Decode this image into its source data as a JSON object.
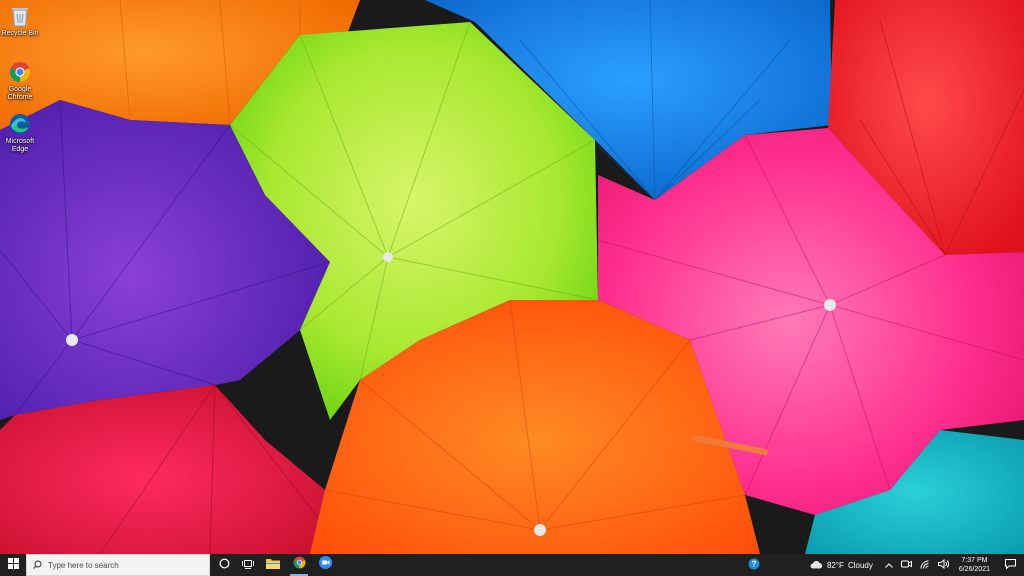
{
  "desktop": {
    "icons": [
      {
        "label": "Recycle Bin",
        "icon": "recycle-bin-icon"
      },
      {
        "label": "Google Chrome",
        "icon": "chrome-icon"
      },
      {
        "label": "Microsoft Edge",
        "icon": "edge-icon"
      }
    ]
  },
  "taskbar": {
    "search_placeholder": "Type here to search",
    "pinned": [
      {
        "name": "File Explorer",
        "icon": "folder-icon"
      },
      {
        "name": "Google Chrome",
        "icon": "chrome-icon"
      },
      {
        "name": "Zoom",
        "icon": "zoom-icon"
      }
    ],
    "weather": {
      "temp": "82°F",
      "condition": "Cloudy"
    },
    "clock": {
      "time": "7:37 PM",
      "date": "6/26/2021"
    }
  },
  "colors": {
    "taskbar_bg": "#202020",
    "accent": "#79b6f2"
  }
}
